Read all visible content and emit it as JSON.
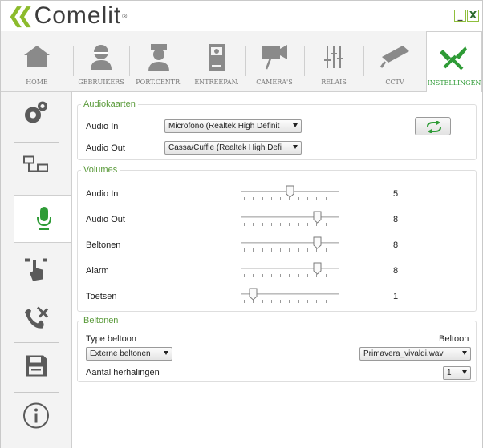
{
  "app": {
    "logo_text": "Comelit",
    "reg_mark": "®"
  },
  "window_controls": {
    "minimize": "_",
    "close": "X"
  },
  "topnav": {
    "tabs": [
      {
        "label": "HOME",
        "icon": "home-icon"
      },
      {
        "label": "GEBRUIKERS",
        "icon": "user-icon"
      },
      {
        "label": "PORT.CENTR.",
        "icon": "concierge-icon"
      },
      {
        "label": "ENTREEPAN.",
        "icon": "door-panel-icon"
      },
      {
        "label": "CAMERA'S",
        "icon": "camera-icon"
      },
      {
        "label": "RELAIS",
        "icon": "relay-icon"
      },
      {
        "label": "CCTV",
        "icon": "cctv-icon"
      },
      {
        "label": "INSTELLINGEN",
        "icon": "tools-icon",
        "active": true
      }
    ]
  },
  "sidebar": {
    "items": [
      {
        "icon": "gears-icon"
      },
      {
        "icon": "network-icon"
      },
      {
        "icon": "microphone-icon",
        "active": true
      },
      {
        "icon": "touch-icon"
      },
      {
        "icon": "phone-tools-icon"
      },
      {
        "icon": "save-icon"
      },
      {
        "icon": "info-icon"
      }
    ]
  },
  "audiokaarten": {
    "legend": "Audiokaarten",
    "audio_in_label": "Audio In",
    "audio_in_value": "Microfono (Realtek High Definit",
    "audio_out_label": "Audio Out",
    "audio_out_value": "Cassa/Cuffie (Realtek High Defi"
  },
  "volumes": {
    "legend": "Volumes",
    "max": 10,
    "rows": [
      {
        "label": "Audio In",
        "value": "5",
        "level": 5
      },
      {
        "label": "Audio Out",
        "value": "8",
        "level": 8
      },
      {
        "label": "Beltonen",
        "value": "8",
        "level": 8
      },
      {
        "label": "Alarm",
        "value": "8",
        "level": 8
      },
      {
        "label": "Toetsen",
        "value": "1",
        "level": 1
      }
    ]
  },
  "beltonen": {
    "legend": "Beltonen",
    "type_label": "Type beltoon",
    "type_value": "Externe beltonen",
    "beltoon_label": "Beltoon",
    "beltoon_value": "Primavera_vivaldi.wav",
    "repeat_label": "Aantal herhalingen",
    "repeat_value": "1"
  },
  "colors": {
    "accent": "#2e9b36",
    "brand_green": "#8cbb2c",
    "legend": "#5a9a3a"
  }
}
